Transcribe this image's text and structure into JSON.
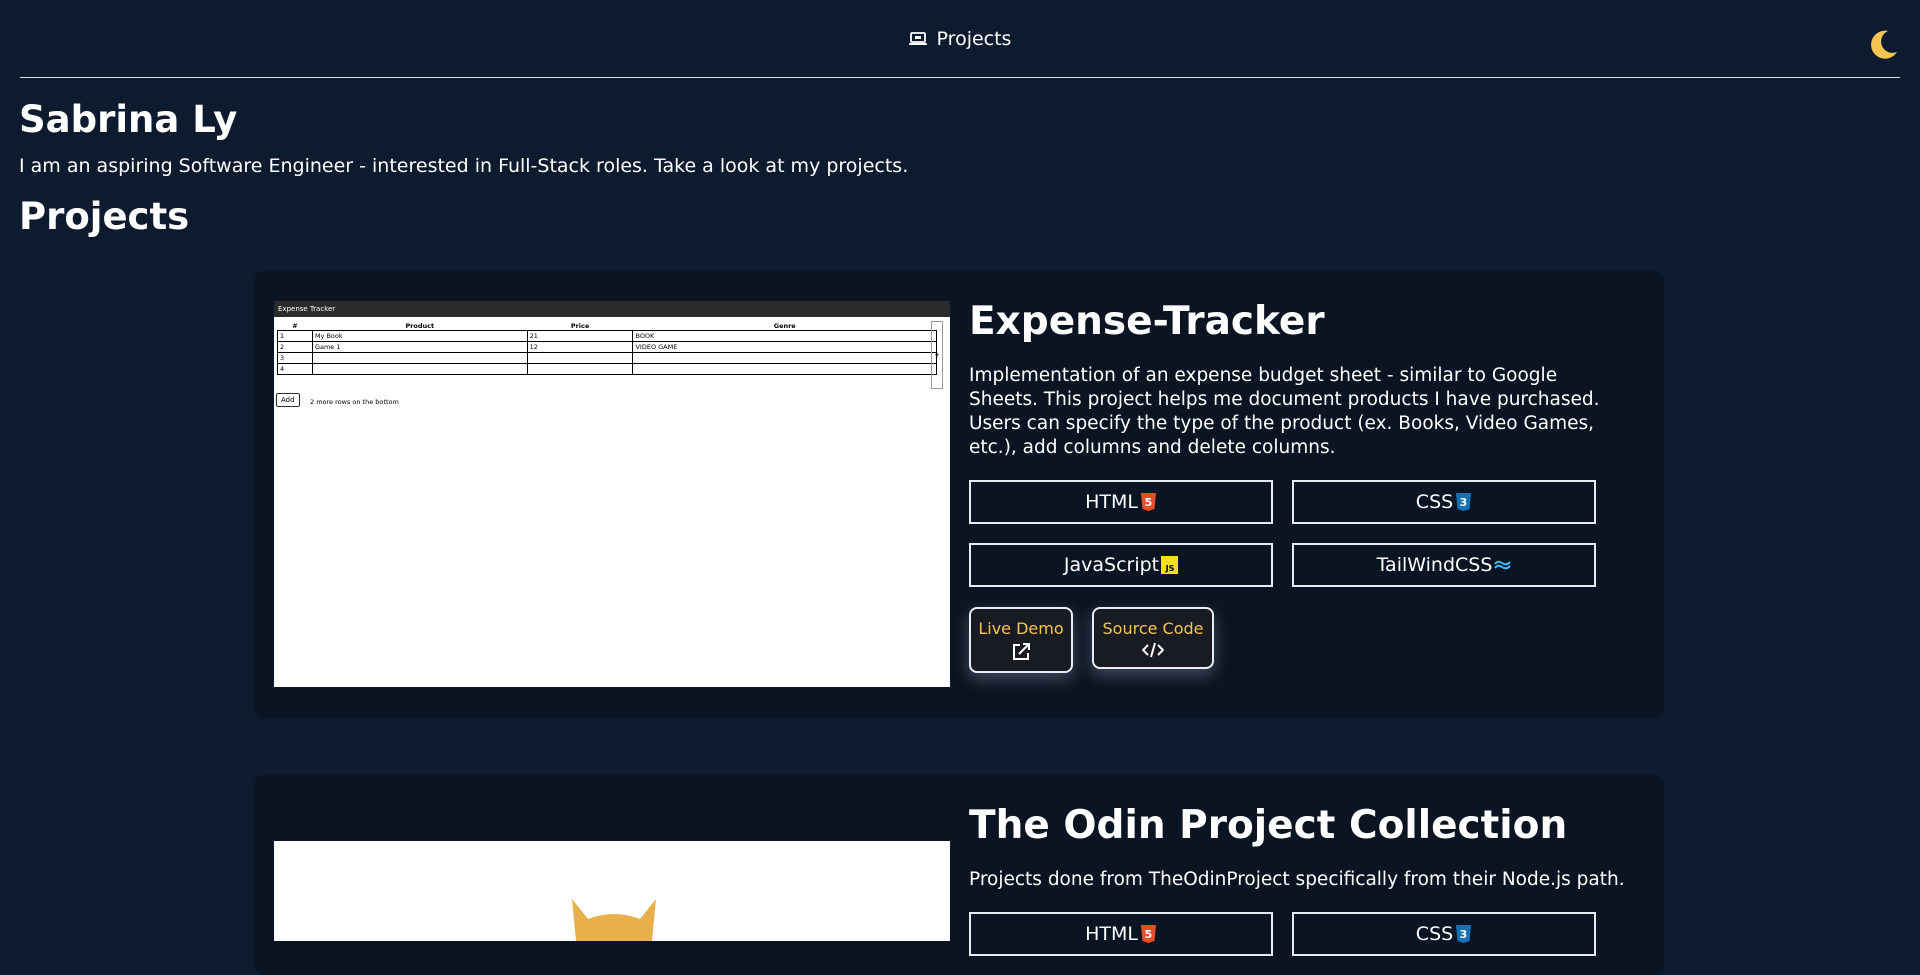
{
  "nav": {
    "projects_label": "Projects"
  },
  "intro": {
    "name": "Sabrina Ly",
    "tagline": "I am an aspiring Software Engineer - interested in Full-Stack roles. Take a look at my projects."
  },
  "projects_heading": "Projects",
  "projects": [
    {
      "title": "Expense-Tracker",
      "description": "Implementation of an expense budget sheet - similar to Google Sheets. This project helps me document products I have purchased. Users can specify the type of the product (ex. Books, Video Games, etc.), add columns and delete columns.",
      "tags": [
        "HTML",
        "CSS",
        "JavaScript",
        "TailWindCSS"
      ],
      "live_demo": "Live Demo",
      "source_code": "Source Code",
      "screenshot": {
        "app_title": "Expense Tracker",
        "headers": [
          "#",
          "Product",
          "Price",
          "Genre"
        ],
        "rows": [
          [
            "1",
            "My Book",
            "21",
            "BOOK"
          ],
          [
            "2",
            "Game 1",
            "12",
            "VIDEO GAME"
          ],
          [
            "3",
            "",
            "",
            ""
          ],
          [
            "4",
            "",
            "",
            ""
          ]
        ],
        "plus": "+",
        "add_label": "Add",
        "more_count": "2",
        "more_text": "more rows on the bottom"
      }
    },
    {
      "title": "The Odin Project Collection",
      "description": "Projects done from TheOdinProject specifically from their Node.js path.",
      "tags": [
        "HTML",
        "CSS"
      ]
    }
  ],
  "colors": {
    "background": "#0e1a2e",
    "card": "#0b1422",
    "accent": "#f6c453",
    "html_badge": "#e34f26",
    "css_badge": "#1572b6",
    "js_badge": "#f7df1e",
    "tailwind_badge": "#38bdf8"
  }
}
